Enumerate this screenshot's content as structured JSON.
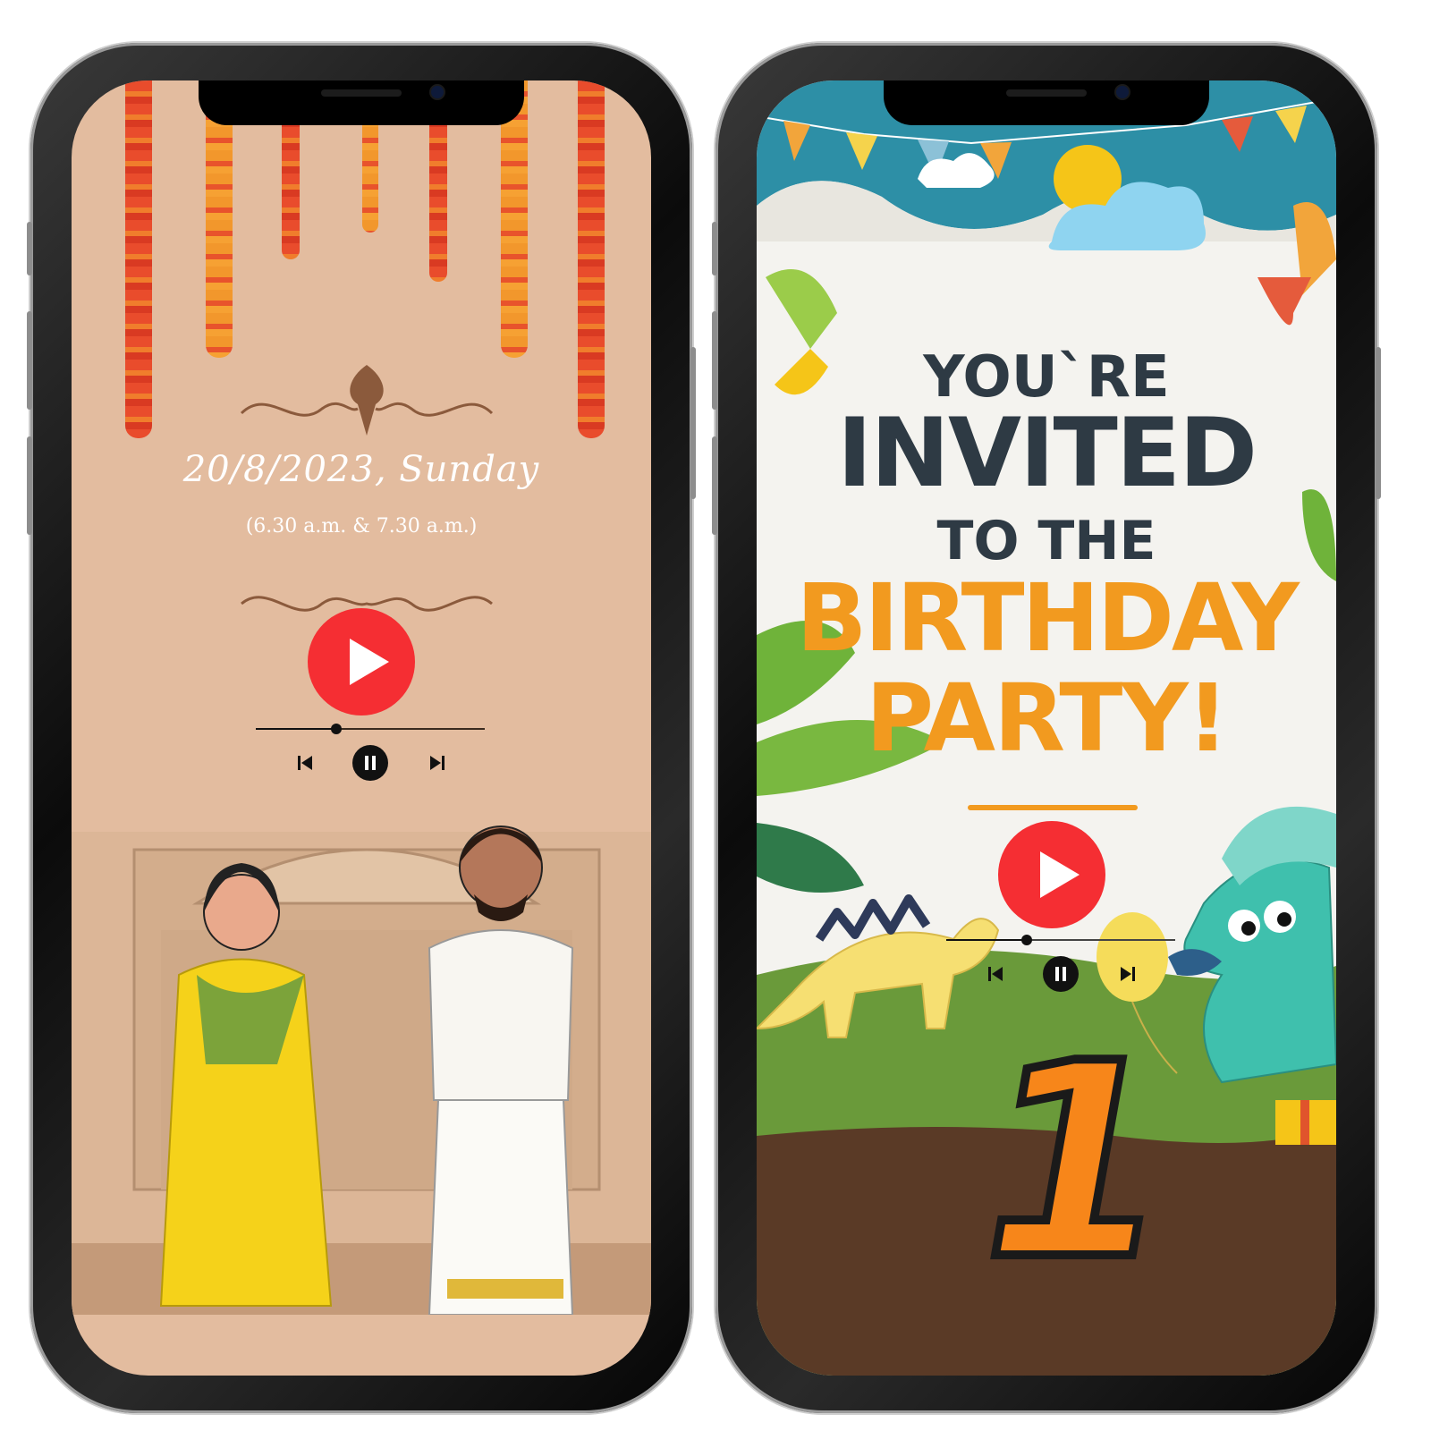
{
  "left_invite": {
    "date": "20/8/2023, Sunday",
    "time": "(6.30 a.m. & 7.30 a.m.)",
    "player": {
      "progress": 0.35
    }
  },
  "right_invite": {
    "line1": "YOU`RE",
    "line2": "INVITED",
    "line3": "TO THE",
    "line4": "BIRTHDAY",
    "line5": "PARTY!",
    "age_number": "1",
    "player": {
      "progress": 0.35
    }
  },
  "colors": {
    "play_button": "#f52e33",
    "left_background": "#e3bc9f",
    "headline_dark": "#2e3a44",
    "headline_orange": "#f29a1f",
    "age_number": "#f7861a"
  },
  "icons": [
    "play-icon",
    "pause-icon",
    "previous-track-icon",
    "next-track-icon"
  ]
}
